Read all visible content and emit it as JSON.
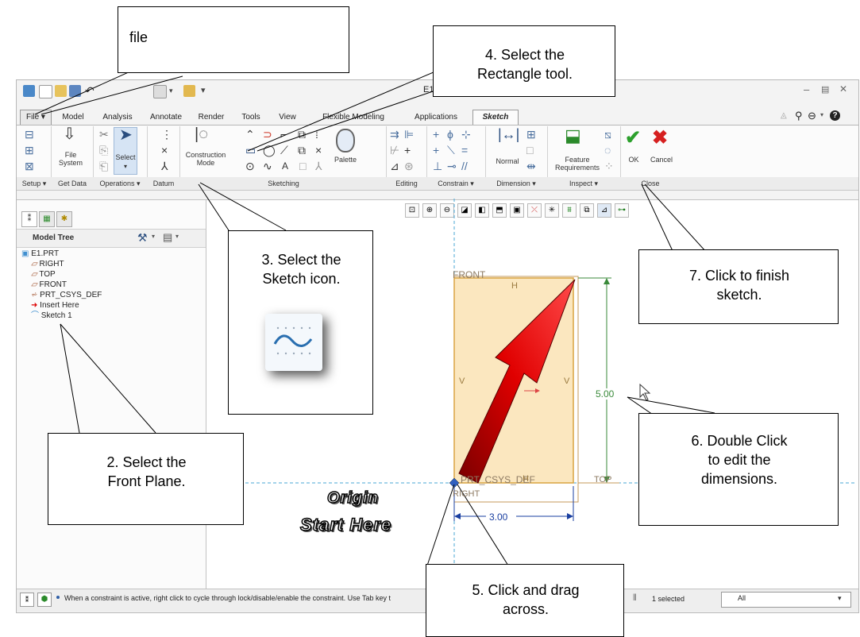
{
  "app": {
    "title": "E1",
    "qat_dropdown": "▾"
  },
  "tabs": [
    {
      "label": "File ▾"
    },
    {
      "label": "Model"
    },
    {
      "label": "Analysis"
    },
    {
      "label": "Annotate"
    },
    {
      "label": "Render"
    },
    {
      "label": "Tools"
    },
    {
      "label": "View"
    },
    {
      "label": "Flexible Modeling"
    },
    {
      "label": "Applications"
    },
    {
      "label": "Sketch"
    }
  ],
  "ribbon": {
    "file_system": "File\nSystem",
    "select": "Select",
    "construction_mode": "Construction\nMode",
    "palette": "Palette",
    "normal": "Normal",
    "feature_requirements": "Feature\nRequirements",
    "ok": "OK",
    "cancel": "Cancel"
  },
  "group_labels": [
    {
      "label": "Setup ▾"
    },
    {
      "label": "Get Data"
    },
    {
      "label": "Operations ▾"
    },
    {
      "label": "Datum"
    },
    {
      "label": "Sketching"
    },
    {
      "label": "Editing"
    },
    {
      "label": "Constrain ▾"
    },
    {
      "label": "Dimension ▾"
    },
    {
      "label": "Inspect ▾"
    },
    {
      "label": "Close"
    }
  ],
  "model_tree": {
    "header": "Model Tree",
    "items": [
      {
        "label": "E1.PRT"
      },
      {
        "label": "RIGHT"
      },
      {
        "label": "TOP"
      },
      {
        "label": "FRONT"
      },
      {
        "label": "PRT_CSYS_DEF"
      },
      {
        "label": "Insert Here"
      },
      {
        "label": "Sketch 1"
      }
    ]
  },
  "sketch": {
    "front_label": "FRONT",
    "top_label": "TOP",
    "right_label": "RIGHT",
    "csys_label": "PRT_CSYS_DEF",
    "h_marker": "H",
    "v_marker": "V",
    "dim_height": "5.00",
    "dim_width": "3.00"
  },
  "status": {
    "message": "When a constraint is active, right click to cycle through lock/disable/enable the constraint. Use Tab key t",
    "selected": "1 selected",
    "filter": "All"
  },
  "callouts": {
    "file": "file",
    "step2": "2. Select the\nFront Plane.",
    "step3": "3. Select the\nSketch icon.",
    "step4": "4. Select the\nRectangle tool.",
    "step5": "5. Click and drag\nacross.",
    "step6": "6. Double Click\nto edit the\ndimensions.",
    "step7": "7. Click to finish\nsketch."
  },
  "origin_text": {
    "line1": "Origin",
    "line2": "Start Here"
  },
  "colors": {
    "sketch_fill": "#fbe7bf",
    "sketch_edge": "#c49a5a",
    "dimension": "#3a8a3a",
    "ok_green": "#2ca02c",
    "cancel_red": "#d62020",
    "arrow_red": "#cc0000"
  }
}
